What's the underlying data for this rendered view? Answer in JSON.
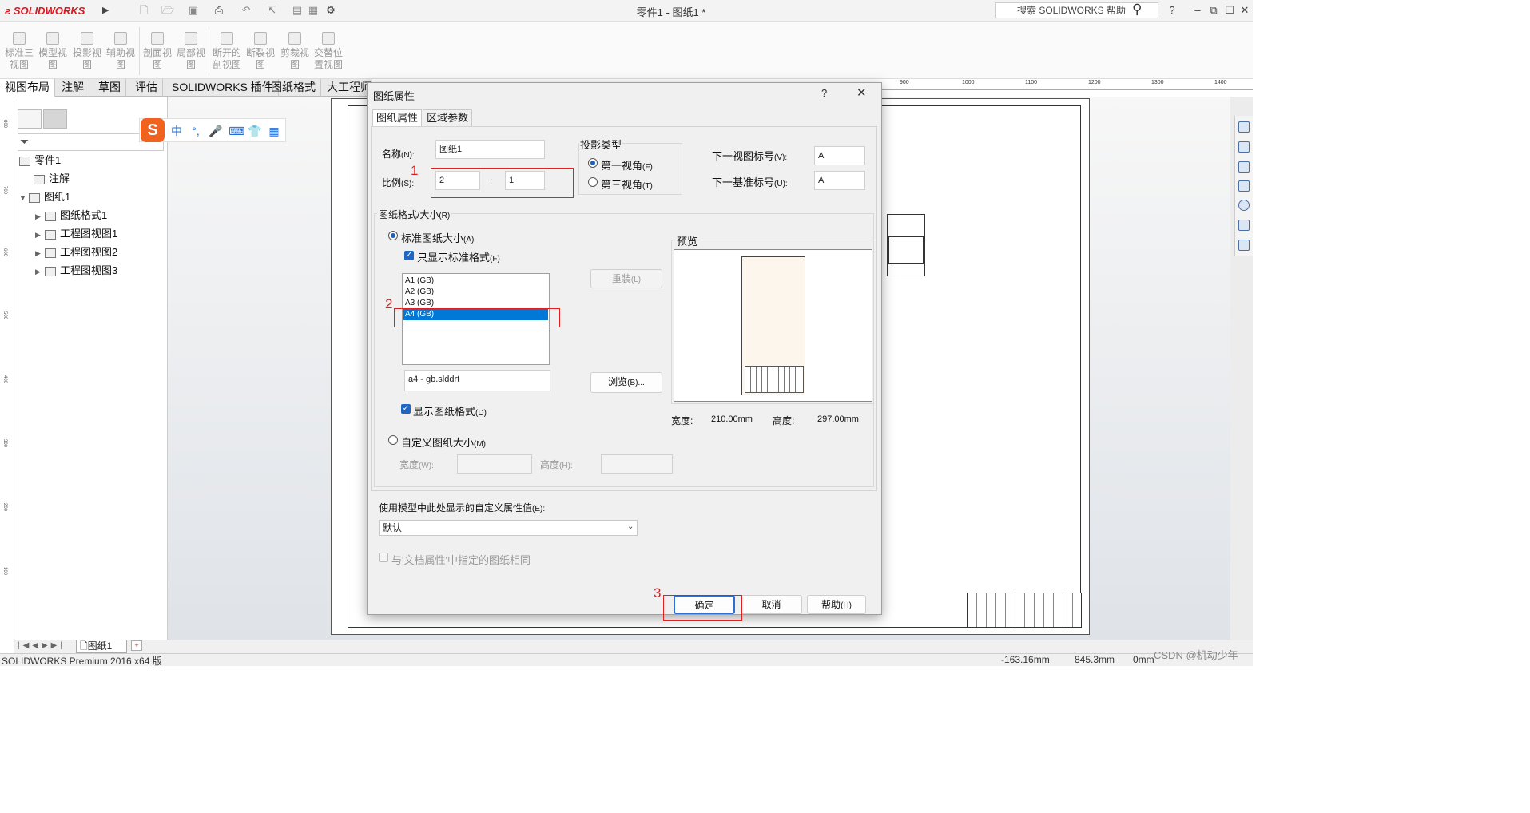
{
  "app": {
    "logo": "SOLIDWORKS",
    "document_title": "零件1 - 图纸1 *",
    "search_placeholder": "搜索 SOLIDWORKS 帮助",
    "help_label": "?"
  },
  "ribbon": {
    "buttons": [
      {
        "line1": "标准三",
        "line2": "视图"
      },
      {
        "line1": "模型视",
        "line2": "图"
      },
      {
        "line1": "投影视",
        "line2": "图"
      },
      {
        "line1": "辅助视",
        "line2": "图"
      },
      {
        "line1": "剖面视",
        "line2": "图"
      },
      {
        "line1": "局部视",
        "line2": "图"
      },
      {
        "line1": "断开的",
        "line2": "剖视图"
      },
      {
        "line1": "断裂视",
        "line2": "图"
      },
      {
        "line1": "剪裁视",
        "line2": "图"
      },
      {
        "line1": "交替位",
        "line2": "置视图"
      }
    ]
  },
  "tabs": [
    "视图布局",
    "注解",
    "草图",
    "评估",
    "SOLIDWORKS 插件",
    "图纸格式",
    "大工程师"
  ],
  "tree": {
    "root": "零件1",
    "annotations": "注解",
    "sheet": "图纸1",
    "children": [
      "图纸格式1",
      "工程图视图1",
      "工程图视图2",
      "工程图视图3"
    ]
  },
  "ime": {
    "logo": "S",
    "lang": "中",
    "punct": "°,"
  },
  "ruler_h": [
    "900",
    "1000",
    "1100",
    "1200",
    "1300",
    "1400"
  ],
  "ruler_v": [
    "800",
    "700",
    "600",
    "500",
    "400",
    "300",
    "200",
    "100"
  ],
  "dialog": {
    "title": "图纸属性",
    "help": "?",
    "close": "✕",
    "tabs": [
      "图纸属性",
      "区域参数"
    ],
    "name_label": "名称",
    "name_key": "(N):",
    "name_value": "图纸1",
    "scale_label": "比例",
    "scale_key": "(S):",
    "scale_num": "2",
    "scale_sep": ":",
    "scale_den": "1",
    "projection_title": "投影类型",
    "first_angle": "第一视角",
    "first_angle_key": "(F)",
    "third_angle": "第三视角",
    "third_angle_key": "(T)",
    "next_view_label": "下一视图标号",
    "next_view_key": "(V):",
    "next_view_value": "A",
    "next_datum_label": "下一基准标号",
    "next_datum_key": "(U):",
    "next_datum_value": "A",
    "format_group": "图纸格式/大小",
    "format_group_key": "(R)",
    "standard_size": "标准图纸大小",
    "standard_size_key": "(A)",
    "only_standard": "只显示标准格式",
    "only_standard_key": "(F)",
    "sizes": [
      "A1 (GB)",
      "A2 (GB)",
      "A3 (GB)",
      "A4 (GB)"
    ],
    "selected_size": "A4 (GB)",
    "reload": "重装",
    "reload_key": "(L)",
    "format_file": "a4 - gb.slddrt",
    "browse": "浏览",
    "browse_key": "(B)...",
    "show_format": "显示图纸格式",
    "show_format_key": "(D)",
    "preview_label": "预览",
    "width_label": "宽度:",
    "width_value": "210.00mm",
    "height_label": "高度:",
    "height_value": "297.00mm",
    "custom_size": "自定义图纸大小",
    "custom_size_key": "(M)",
    "custom_width_label": "宽度",
    "custom_width_key": "(W):",
    "custom_height_label": "高度",
    "custom_height_key": "(H):",
    "custom_prop_label": "使用模型中此处显示的自定义属性值",
    "custom_prop_key": "(E):",
    "custom_prop_value": "默认",
    "same_as_doc": "与'文档属性'中指定的图纸相同",
    "ok": "确定",
    "cancel": "取消",
    "help_button": "帮助",
    "help_button_key": "(H)"
  },
  "annotations": {
    "n1": "1",
    "n2": "2",
    "n3": "3"
  },
  "sheet_tab": "图纸1",
  "status": {
    "product": "SOLIDWORKS Premium 2016 x64 版",
    "x": "-163.16mm",
    "y": "845.3mm",
    "z": "0mm",
    "watermark": "CSDN @机动少年"
  },
  "colors": {
    "accent": "#0078d7",
    "annotation": "#e02020",
    "brand": "#d71920"
  }
}
